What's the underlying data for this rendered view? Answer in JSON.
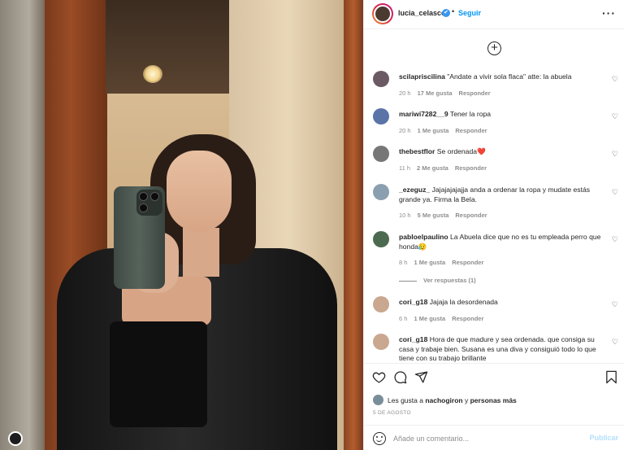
{
  "header": {
    "username": "lucia_celasco",
    "verified_mark": "✔",
    "separator": "•",
    "follow_label": "Seguir",
    "more_label": "···"
  },
  "add_label": "+",
  "comments": [
    {
      "user": "scilapriscilina",
      "text": "\"Andate a vivir sola flaca\" atte: la abuela",
      "time": "20 h",
      "likes": "17 Me gusta",
      "reply": "Responder",
      "avatar_color": "#6b5a64"
    },
    {
      "user": "mariwi7282__9",
      "text": "Tener la ropa",
      "time": "20 h",
      "likes": "1 Me gusta",
      "reply": "Responder",
      "avatar_color": "#5a74a8"
    },
    {
      "user": "thebestflor",
      "text": "Se ordenada❤️",
      "time": "11 h",
      "likes": "2 Me gusta",
      "reply": "Responder",
      "avatar_color": "#777777"
    },
    {
      "user": "_ezeguz_",
      "text": "Jajajajajajja anda a ordenar la ropa y mudate estás grande ya. Firma la Bela.",
      "time": "10 h",
      "likes": "5 Me gusta",
      "reply": "Responder",
      "avatar_color": "#8aa0b0"
    },
    {
      "user": "pabloelpaulino",
      "text": "La Abuela dice que no es tu empleada perro que honda😥",
      "time": "8 h",
      "likes": "1 Me gusta",
      "reply": "Responder",
      "avatar_color": "#4c6a4f"
    },
    {
      "user": "cori_g18",
      "text": "Jajaja la desordenada",
      "time": "6 h",
      "likes": "1 Me gusta",
      "reply": "Responder",
      "avatar_color": "#c9a88f"
    },
    {
      "user": "cori_g18",
      "text": "Hora de que madure y sea ordenada. que consiga su casa y trabaje bien. Susana es una diva y consiguió todo lo que tiene con su trabajo brillante",
      "time": "",
      "likes": "",
      "reply": "",
      "avatar_color": "#c9a88f"
    }
  ],
  "view_replies": "Ver respuestas (1)",
  "heart_glyph": "♡",
  "likes": {
    "prefix": "Les gusta a",
    "user": "nachogiron",
    "mid": "y",
    "rest": "personas más"
  },
  "date": "5 DE AGOSTO",
  "comment_box": {
    "placeholder": "Añade un comentario...",
    "publish": "Publicar"
  }
}
